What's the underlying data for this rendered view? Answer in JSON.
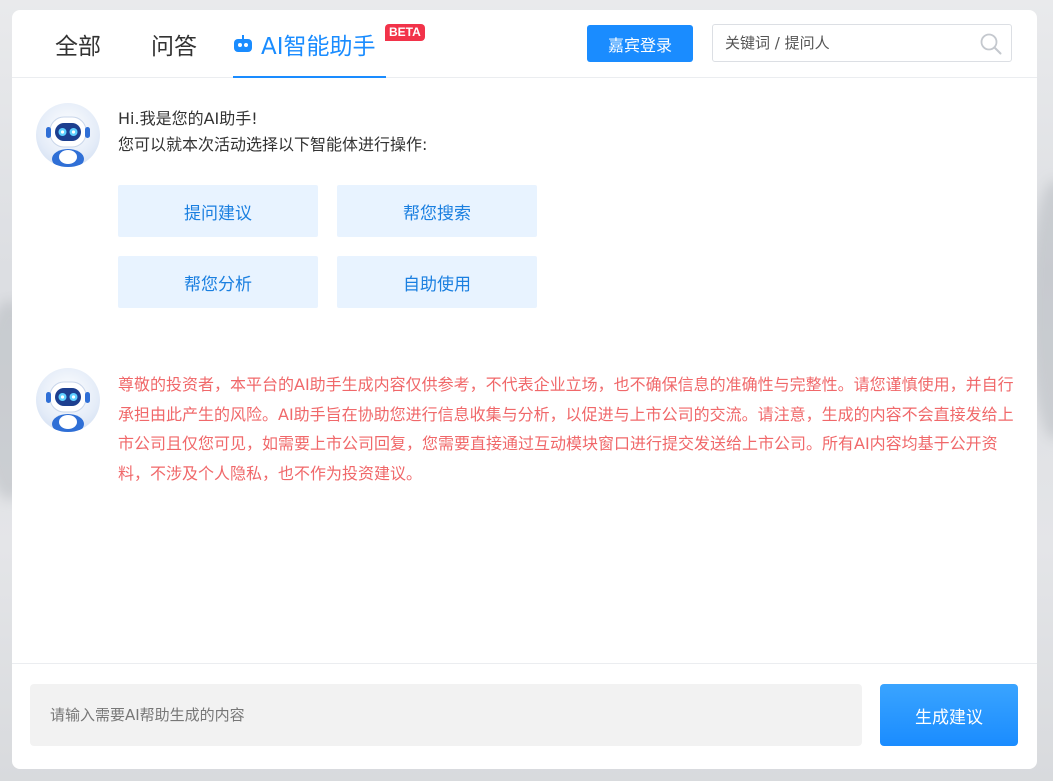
{
  "tabs": [
    {
      "label": "全部"
    },
    {
      "label": "问答"
    },
    {
      "label": "AI智能助手",
      "badge": "BETA",
      "active": true
    }
  ],
  "header": {
    "login_label": "嘉宾登录",
    "search_placeholder": "关键词 / 提问人"
  },
  "greeting": {
    "line1": "Hi.我是您的AI助手!",
    "line2": "您可以就本次活动选择以下智能体进行操作:"
  },
  "agents": [
    {
      "label": "提问建议"
    },
    {
      "label": "帮您搜索"
    },
    {
      "label": "帮您分析"
    },
    {
      "label": "自助使用"
    }
  ],
  "disclaimer": "尊敬的投资者，本平台的AI助手生成内容仅供参考，不代表企业立场，也不确保信息的准确性与完整性。请您谨慎使用，并自行承担由此产生的风险。AI助手旨在协助您进行信息收集与分析，以促进与上市公司的交流。请注意，生成的内容不会直接发给上市公司且仅您可见，如需要上市公司回复，您需要直接通过互动模块窗口进行提交发送给上市公司。所有AI内容均基于公开资料，不涉及个人隐私，也不作为投资建议。",
  "footer": {
    "input_placeholder": "请输入需要AI帮助生成的内容",
    "generate_label": "生成建议"
  },
  "colors": {
    "accent": "#1a8cff",
    "chip_bg": "#e8f3ff",
    "disclaimer_text": "#f0686a",
    "beta_badge": "#f2334a"
  },
  "icons": [
    "robot-icon",
    "search-icon",
    "robot-avatar-icon"
  ]
}
